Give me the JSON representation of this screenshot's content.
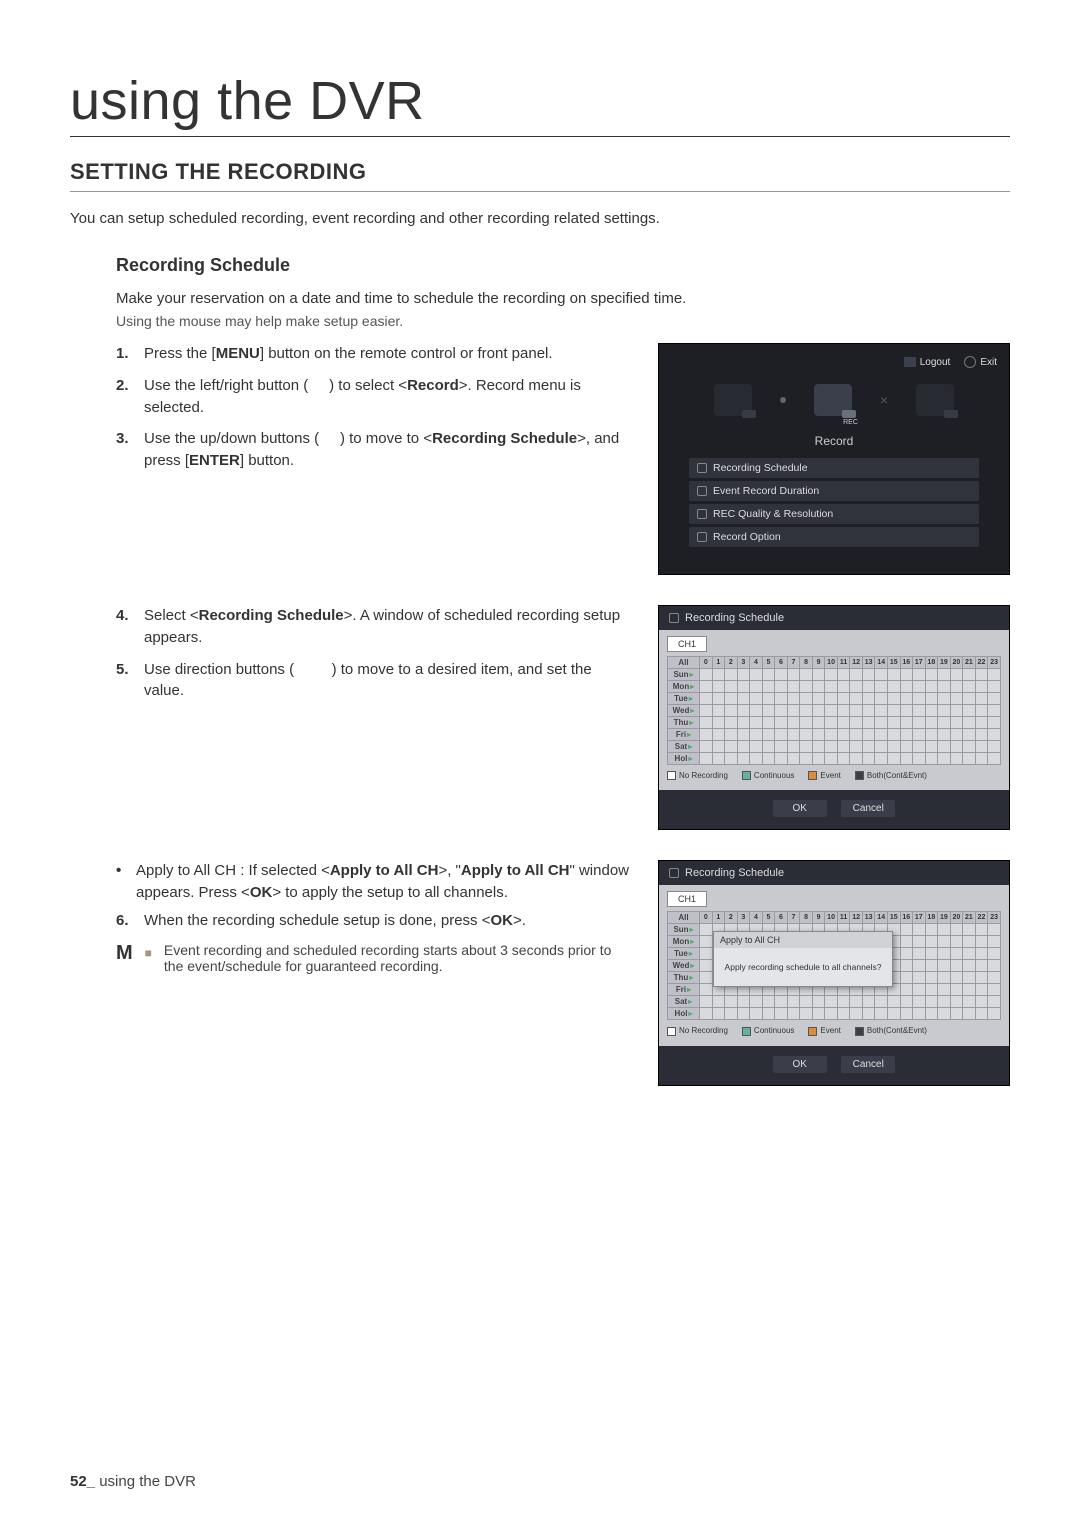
{
  "h1": "using the DVR",
  "h2": "SETTING THE RECORDING",
  "intro": "You can setup scheduled recording, event recording and other recording related settings.",
  "h3": "Recording Schedule",
  "lead": "Make your reservation on a date and time to schedule the recording on specified time.",
  "sublead": "Using the mouse may help make setup easier.",
  "steps1": {
    "1a": "Press the [",
    "1b": "MENU",
    "1c": "] button on the remote control or front panel.",
    "2a": "Use the left/right button (",
    "2b": ") to select <",
    "2c": "Record",
    "2d": ">. Record menu is selected.",
    "3a": "Use the up/down buttons (",
    "3b": ") to move to <",
    "3c": "Recording Schedule",
    "3d": ">, and press [",
    "3e": "ENTER",
    "3f": "] button."
  },
  "steps2": {
    "4a": "Select <",
    "4b": "Recording Schedule",
    "4c": ">. A window of scheduled recording setup appears.",
    "5a": "Use direction buttons (",
    "5b": ") to move to a desired item, and set the value."
  },
  "block3": {
    "bullet_a": "Apply to All CH : If selected <",
    "bullet_b": "Apply to All CH",
    "bullet_c": ">, \"",
    "bullet_d": "Apply to All CH",
    "bullet_e": "\" window appears. Press <",
    "bullet_f": "OK",
    "bullet_g": "> to apply the setup to all channels.",
    "6a": "When the recording schedule setup is done, press <",
    "6b": "OK",
    "6c": ">.",
    "note": "Event recording and scheduled recording starts about 3 seconds prior to the event/schedule for guaranteed recording."
  },
  "scrn1": {
    "logout": "Logout",
    "exit": "Exit",
    "rec_badge": "REC",
    "label": "Record",
    "items": [
      "Recording Schedule",
      "Event Record Duration",
      "REC Quality & Resolution",
      "Record Option"
    ]
  },
  "sched": {
    "title": "Recording Schedule",
    "ch": "CH1",
    "allrow": "All",
    "days": [
      "Sun",
      "Mon",
      "Tue",
      "Wed",
      "Thu",
      "Fri",
      "Sat",
      "Hol"
    ],
    "hours": [
      "0",
      "1",
      "2",
      "3",
      "4",
      "5",
      "6",
      "7",
      "8",
      "9",
      "10",
      "11",
      "12",
      "13",
      "14",
      "15",
      "16",
      "17",
      "18",
      "19",
      "20",
      "21",
      "22",
      "23"
    ],
    "legend": {
      "no": "No Recording",
      "cont": "Continuous",
      "event": "Event",
      "both": "Both(Cont&Evnt)"
    },
    "ok": "OK",
    "cancel": "Cancel"
  },
  "modal": {
    "title": "Apply to All CH",
    "body": "Apply recording schedule to all channels?"
  },
  "note_marker": "M",
  "footer": {
    "page": "52_",
    "text": "using the DVR"
  }
}
